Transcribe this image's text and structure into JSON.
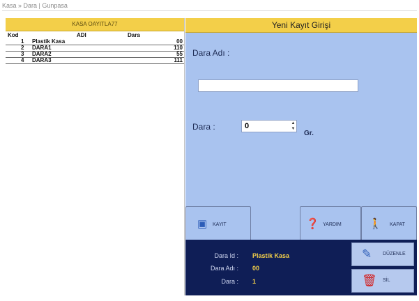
{
  "breadcrumb": "Kasa » Dara | Gunpasa",
  "list": {
    "title": "KASA OAYITLA77",
    "columns": {
      "kod": "Kod",
      "adi": "ADI",
      "dara": "Dara"
    },
    "rows": [
      {
        "kod": "1",
        "adi": "Plastik Kasa",
        "dara": "00"
      },
      {
        "kod": "2",
        "adi": "DARA1",
        "dara": "110"
      },
      {
        "kod": "3",
        "adi": "DARA2",
        "dara": "55"
      },
      {
        "kod": "4",
        "adi": "DARA3",
        "dara": "111"
      }
    ]
  },
  "form": {
    "title": "Yeni Kayıt Girişi",
    "name_label": "Dara Adı :",
    "name_value": "",
    "weight_label": "Dara :",
    "weight_value": "0",
    "weight_unit": "Gr."
  },
  "tabs": {
    "save_label": "KAYIT",
    "help_label": "YARDIM",
    "exit_label": "KAPAT"
  },
  "info": {
    "id_label": "Dara Id :",
    "id_value": "Plastik Kasa",
    "name_label": "Dara Adı :",
    "name_value": "00",
    "weight_label": "Dara :",
    "weight_value": "1"
  },
  "actions": {
    "edit_label": "DÜZENLE",
    "delete_label": "SİL"
  },
  "icons": {
    "save": "floppy-disk-icon",
    "help": "question-icon",
    "exit": "person-exit-icon",
    "edit": "edit-icon",
    "delete": "trash-icon"
  },
  "colors": {
    "header_yellow": "#f3cf49",
    "form_blue": "#a9c3ef",
    "info_navy": "#0f1e56",
    "info_value": "#f3cf49",
    "delete_red": "#d32020"
  }
}
